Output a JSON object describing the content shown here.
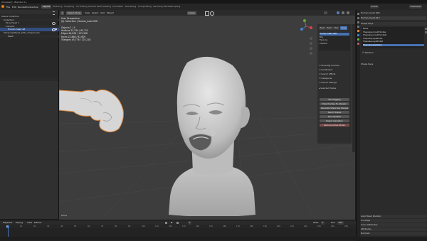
{
  "app": {
    "title": "[Unsaved] - Blender 4.1"
  },
  "menu": [
    "File",
    "Edit",
    "Render",
    "Window",
    "Help"
  ],
  "workspaces": [
    "Layout",
    "Modeling",
    "Sculpting",
    "UV Editing",
    "Texture Paint",
    "Shading",
    "Animation",
    "Rendering",
    "Compositing",
    "Geometry Nodes",
    "Scripting"
  ],
  "scene": {
    "scene_label": "Scene",
    "viewlayer_label": "ViewLayer"
  },
  "outliner": {
    "rows": [
      "Scene Collection",
      "Collection",
      "Face_Head 1",
      "Camera",
      "Human head alt",
      "ShowcaseHead_with_components",
      "Mesh"
    ]
  },
  "viewport": {
    "mode": "Object Mode",
    "menus": [
      "View",
      "Select",
      "Add",
      "Object"
    ],
    "orientation": "Global",
    "overlay_lines": [
      "User Perspective",
      "(0) Collection | Human_head 006",
      "",
      "Objects    1 / 4",
      "Vertices   23,234 / 62,712",
      "Edges      46,098 / 125,306",
      "Faces      22,886 / 62,609",
      "Triangles  45,776 / 125,218"
    ],
    "bottom_label": "Move"
  },
  "npanel": {
    "tabs": [
      "Rest",
      "Item",
      "Tool",
      "View"
    ],
    "list_items": [
      "Human head 006",
      "Rig",
      "Face rig",
      "Camera"
    ],
    "checklist": [
      "Show Rig Controls",
      "Subdivision",
      "Search Afflicts",
      "Categories",
      "Search settings",
      "Selected Modes"
    ],
    "buttons": [
      "Face Rigging",
      "Export Active To Adjuster",
      "Generate Shape Key Ranges",
      "Search Dupes",
      "Save Updater",
      "Export Animation",
      "Remove Active Modes"
    ]
  },
  "properties": {
    "object_name": "Human_head 006",
    "data_name": "Human_head.013",
    "section_title": "Shape Keys",
    "shape_keys": [
      "Basis",
      "Shapekey.mouthSmileL",
      "Shapekey.mouthSmileR",
      "Shapekey.eyeBlinkL",
      "Shapekey.eyeBlinkR",
      "Shapekey.jawOpen"
    ],
    "selected_shape_key": 5,
    "lower_sections": [
      "Relative",
      "Shape Keys"
    ],
    "bottom_sections": [
      "Auto Mesh Position",
      "UV Maps",
      "Color Attributes",
      "Attributes",
      "Normals"
    ]
  },
  "timeline": {
    "menus": [
      "Playback",
      "Keying",
      "View",
      "Marker"
    ],
    "frame_current": "1",
    "start_label": "Start",
    "start": "1",
    "end_label": "End",
    "end": "250",
    "ticks": [
      "0",
      "10",
      "20",
      "30",
      "40",
      "50",
      "60",
      "70",
      "80",
      "90",
      "100",
      "110",
      "120",
      "130",
      "140",
      "150",
      "160",
      "170",
      "180",
      "190",
      "200",
      "210",
      "220",
      "230",
      "240",
      "250"
    ]
  },
  "colors": {
    "accent": "#4772b3",
    "selection_outline": "#e0883a",
    "viewport_bg": "#3d3d3d"
  }
}
